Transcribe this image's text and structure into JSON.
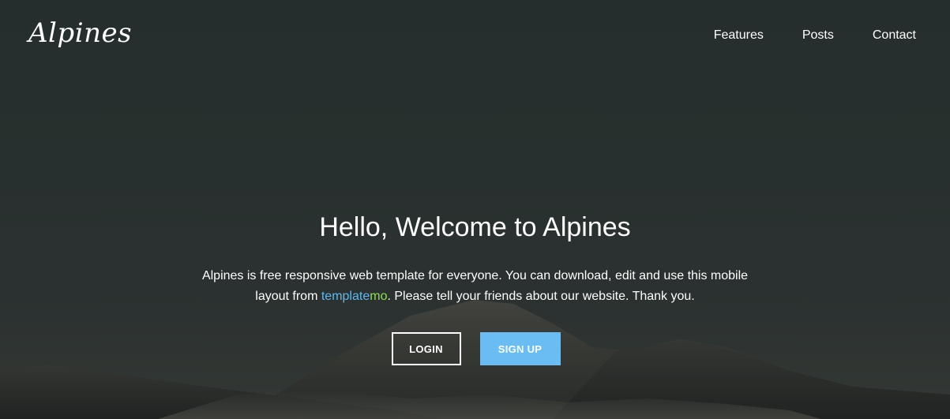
{
  "header": {
    "logo": "Alpines",
    "nav": [
      {
        "label": "Features"
      },
      {
        "label": "Posts"
      },
      {
        "label": "Contact"
      }
    ]
  },
  "hero": {
    "title": "Hello, Welcome to Alpines",
    "description_part1": "Alpines is free responsive web template for everyone. You can download, edit and use this mobile layout from ",
    "brand_part1": "template",
    "brand_part2": "mo",
    "description_part2": ". Please tell your friends about our website. Thank you.",
    "login_label": "LOGIN",
    "signup_label": "SIGN UP"
  },
  "colors": {
    "accent_blue": "#69bdf3",
    "brand_blue": "#5fb8ec",
    "brand_green": "#8de04a"
  }
}
